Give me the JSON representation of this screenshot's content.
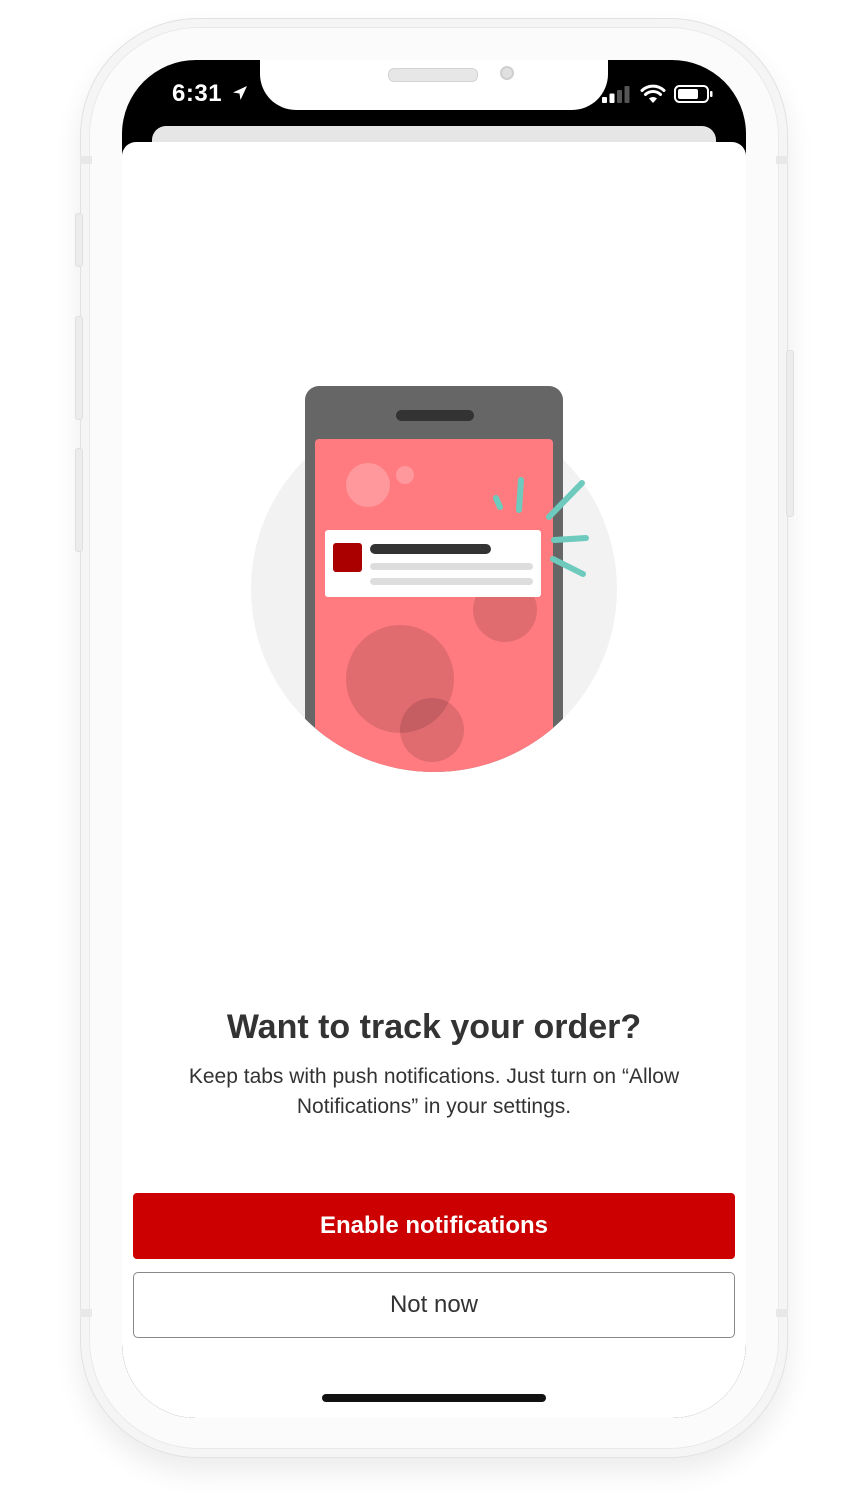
{
  "status_bar": {
    "time": "6:31"
  },
  "prompt": {
    "title": "Want to track your order?",
    "description": "Keep tabs with push notifications. Just turn on “Allow Notifications” in your settings."
  },
  "actions": {
    "enable_label": "Enable notifications",
    "dismiss_label": "Not now"
  },
  "colors": {
    "primary": "#cc0000",
    "illustration_screen": "#ff7b80",
    "accent_rays": "#6dcabd"
  }
}
